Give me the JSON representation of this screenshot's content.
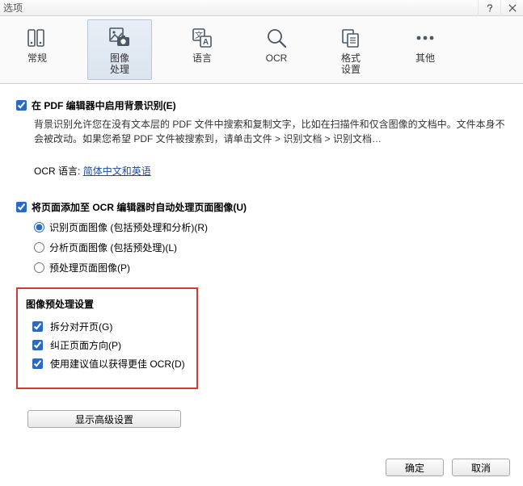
{
  "window": {
    "title": "选项"
  },
  "toolbar": {
    "general": "常规",
    "image": "图像\n处理",
    "language": "语言",
    "ocr": "OCR",
    "format": "格式\n设置",
    "other": "其他"
  },
  "section1": {
    "checkbox_label": "在 PDF 编辑器中启用背景识别(E)",
    "desc": "背景识别允许您在没有文本层的 PDF 文件中搜索和复制文字，比如在扫描件和仅含图像的文档中。文件本身不会被改动。如果您希望 PDF 文件被搜索到，请单击文件 > 识别文档 > 识别文档…",
    "ocr_lang_label": "OCR 语言:",
    "ocr_lang_value": "简体中文和英语"
  },
  "section2": {
    "checkbox_label": "将页面添加至 OCR 编辑器时自动处理页面图像(U)",
    "radio1": "识别页面图像 (包括预处理和分析)(R)",
    "radio2": "分析页面图像 (包括预处理)(L)",
    "radio3": "预处理页面图像(P)"
  },
  "preproc": {
    "title": "图像预处理设置",
    "c1": "拆分对开页(G)",
    "c2": "纠正页面方向(P)",
    "c3": "使用建议值以获得更佳 OCR(D)"
  },
  "buttons": {
    "advanced": "显示高级设置",
    "ok": "确定",
    "cancel": "取消"
  }
}
